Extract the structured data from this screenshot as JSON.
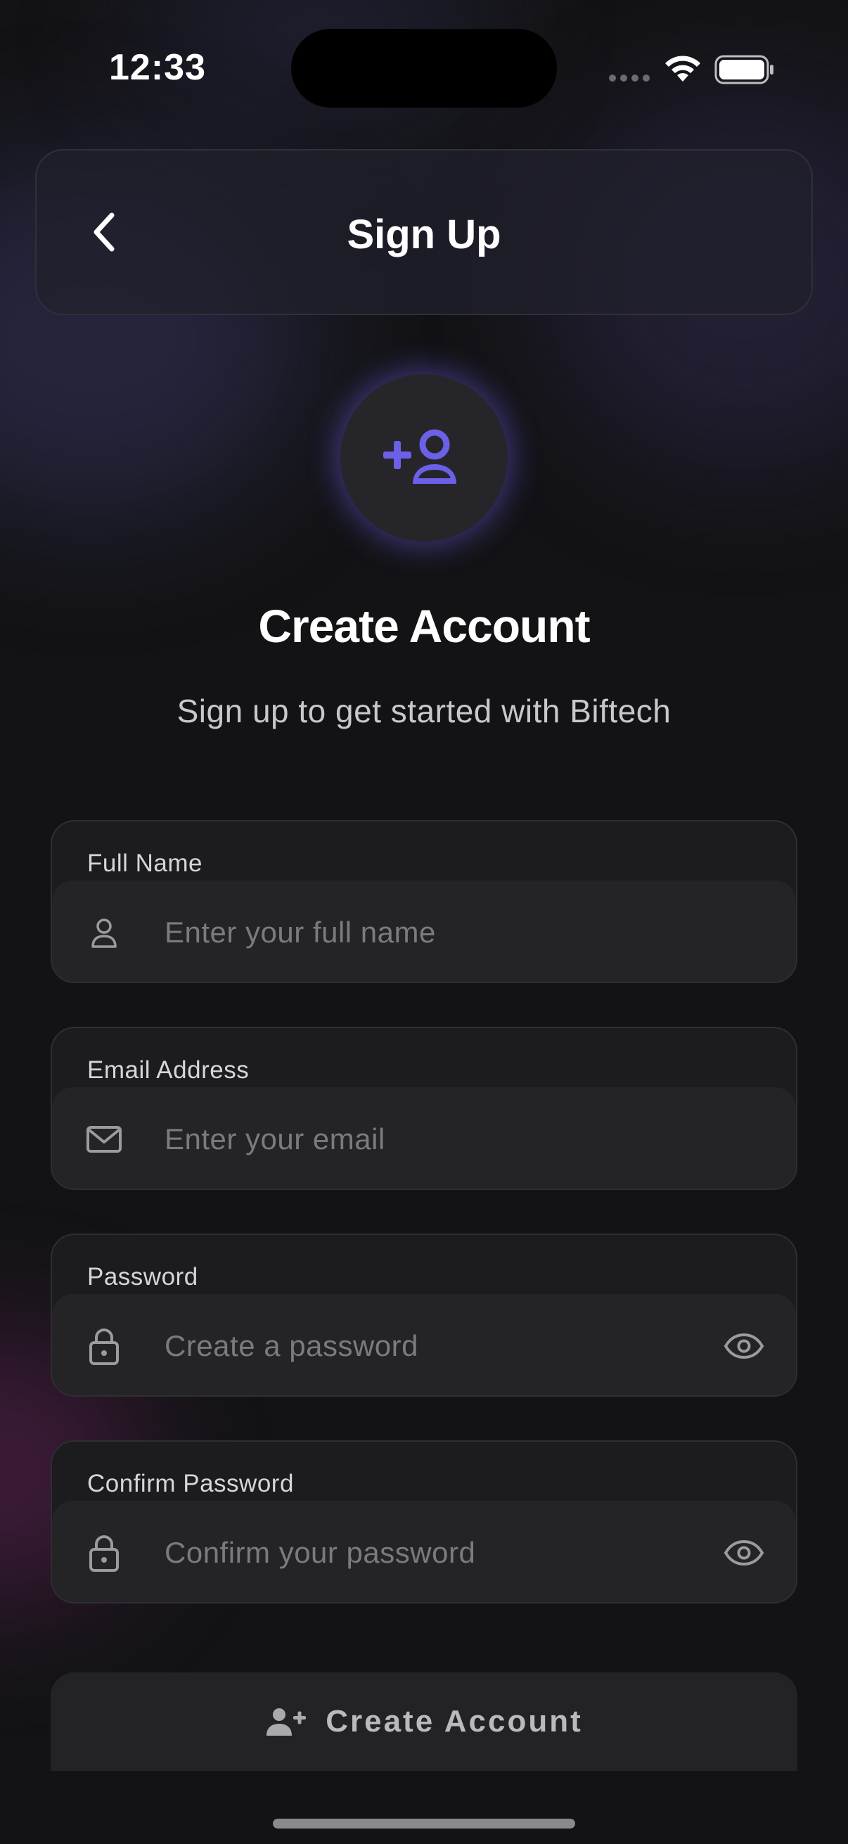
{
  "status_bar": {
    "time": "12:33"
  },
  "header": {
    "title": "Sign Up",
    "back_icon": "chevron-left-icon"
  },
  "hero": {
    "icon": "person-add-icon",
    "title": "Create Account",
    "subtitle": "Sign up to get started with Biftech"
  },
  "form": {
    "fields": [
      {
        "label": "Full Name",
        "placeholder": "Enter your full name",
        "icon": "person-icon",
        "has_visibility_toggle": false
      },
      {
        "label": "Email Address",
        "placeholder": "Enter your email",
        "icon": "envelope-icon",
        "has_visibility_toggle": false
      },
      {
        "label": "Password",
        "placeholder": "Create a password",
        "icon": "lock-icon",
        "has_visibility_toggle": true
      },
      {
        "label": "Confirm Password",
        "placeholder": "Confirm your password",
        "icon": "lock-icon",
        "has_visibility_toggle": true
      }
    ],
    "submit": {
      "label": "Create Account",
      "icon": "person-add-icon"
    }
  },
  "colors": {
    "background": "#131316",
    "accent": "#6c5fe8",
    "field_background": "#242426",
    "placeholder": "#7a7a80"
  }
}
